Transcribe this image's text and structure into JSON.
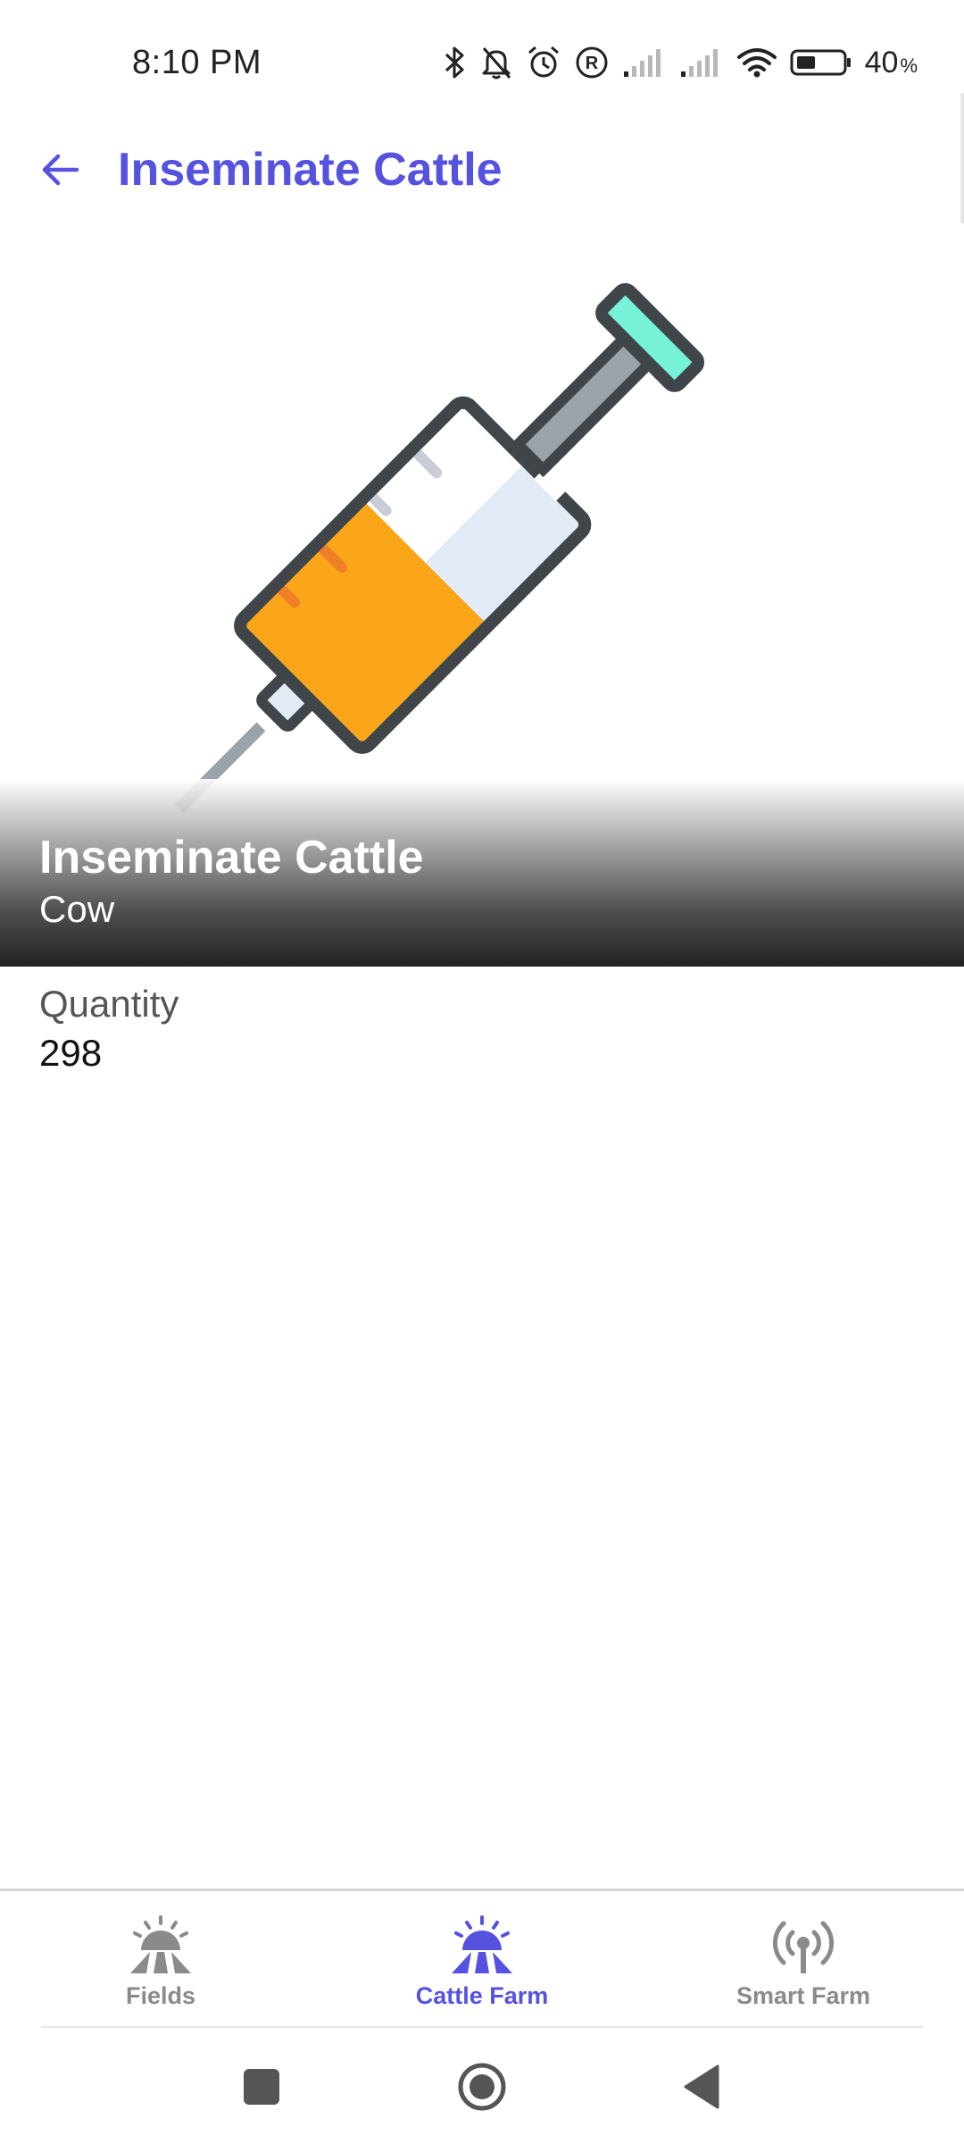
{
  "status_bar": {
    "time": "8:10 PM",
    "battery_percent": "40",
    "battery_unit": "%",
    "icons": [
      "bluetooth-icon",
      "bell-off-icon",
      "alarm-icon",
      "registered-icon",
      "signal-icon",
      "signal-icon",
      "wifi-icon",
      "battery-icon"
    ]
  },
  "app_bar": {
    "back_icon": "arrow-left-icon",
    "title": "Inseminate Cattle"
  },
  "hero": {
    "image": "syringe-illustration",
    "title": "Inseminate Cattle",
    "subtitle": "Cow"
  },
  "details": {
    "label": "Quantity",
    "value": "298"
  },
  "bottom_nav": {
    "items": [
      {
        "label": "Fields",
        "icon": "field-sunrise-icon",
        "active": false
      },
      {
        "label": "Cattle Farm",
        "icon": "field-sunrise-icon",
        "active": true
      },
      {
        "label": "Smart Farm",
        "icon": "broadcast-antenna-icon",
        "active": false
      }
    ]
  },
  "colors": {
    "accent": "#5552e0",
    "inactive": "#8a8a8a",
    "syringe_outline": "#3f4549",
    "syringe_liquid": "#fba519",
    "syringe_plunger_cap": "#76f2d8",
    "syringe_glass": "#e2ebf5"
  }
}
